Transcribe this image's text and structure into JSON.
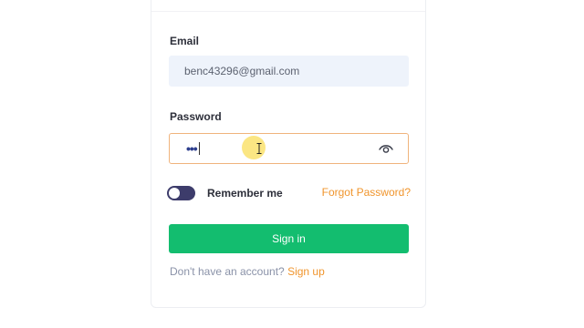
{
  "form": {
    "email_label": "Email",
    "email_value": "benc43296@gmail.com",
    "password_label": "Password",
    "password_masked": "•••",
    "show_password_icon": "eye-icon",
    "remember_label": "Remember me",
    "remember_checked": true,
    "forgot_label": "Forgot Password?",
    "signin_label": "Sign in",
    "signup_prompt": "Don't have an account?",
    "signup_link": "Sign up"
  },
  "colors": {
    "accent_green": "#13bd6f",
    "link_orange": "#f0952d",
    "toggle_dark": "#3d3c6b",
    "input_bg": "#eef3fb",
    "focus_border": "#f0b37c"
  }
}
